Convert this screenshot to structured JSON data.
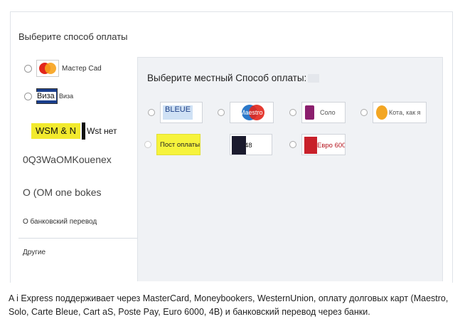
{
  "page": {
    "title": "Выберите способ оплаты"
  },
  "left_options": [
    {
      "label": "Мастер Cad"
    },
    {
      "label": "Виза",
      "logo_text": "Виза"
    },
    {
      "label": "Wst нет",
      "logo_text": "WSM & N"
    },
    {
      "label": "0Q3WaOMKouenex"
    },
    {
      "label": "O (OM one bokes"
    },
    {
      "label": "О банковский перевод"
    }
  ],
  "others_label": "Другие",
  "local": {
    "title": "Выберите местный Способ оплаты:",
    "methods": [
      {
        "name": "carte-bleue",
        "label": "BLEUE"
      },
      {
        "name": "maestro",
        "label": "Maestro"
      },
      {
        "name": "solo",
        "label": "Соло"
      },
      {
        "name": "cartasi",
        "label": "Кота, как я"
      },
      {
        "name": "postepay",
        "label": "Пост оплаты"
      },
      {
        "name": "4b",
        "label": "48"
      },
      {
        "name": "euro6000",
        "label": "Евро 6000"
      }
    ]
  },
  "caption": "A i Express поддерживает через MasterCard, Moneybookers, WesternUnion, оплату долговых карт (Maestro, Solo, Carte Bleue, Cart aS, Poste Pay, Euro 6000, 4B) и банковский перевод через банки."
}
